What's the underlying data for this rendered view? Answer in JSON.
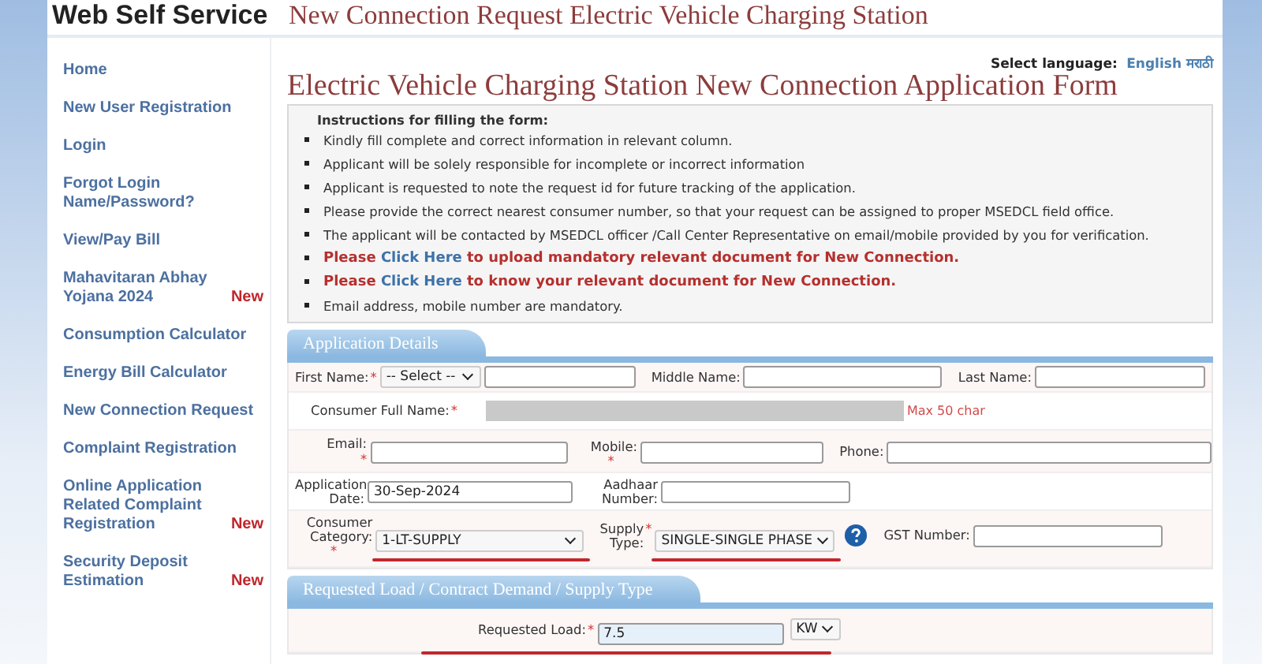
{
  "header": {
    "site_title": "Web Self Service",
    "page_title": "New Connection Request Electric Vehicle Charging Station"
  },
  "sidebar": {
    "items": [
      {
        "label": "Home"
      },
      {
        "label": "New User Registration"
      },
      {
        "label": "Login"
      },
      {
        "label": "Forgot Login Name/Password?"
      },
      {
        "label": "View/Pay Bill"
      },
      {
        "label": "Mahavitaran Abhay Yojana 2024",
        "badge": "New"
      },
      {
        "label": "Consumption Calculator"
      },
      {
        "label": "Energy Bill Calculator"
      },
      {
        "label": "New Connection Request"
      },
      {
        "label": "Complaint Registration"
      },
      {
        "label": "Online Application Related Complaint Registration",
        "badge": "New"
      },
      {
        "label": "Security Deposit Estimation",
        "badge": "New"
      }
    ]
  },
  "language": {
    "label": "Select language:",
    "options": [
      "English",
      "मराठी"
    ]
  },
  "form_title": "Electric Vehicle Charging Station New Connection Application Form",
  "instructions": {
    "heading": "Instructions for filling the form:",
    "items": [
      {
        "kind": "plain",
        "text": "Kindly fill complete and correct information in relevant column."
      },
      {
        "kind": "plain",
        "text": "Applicant will be solely responsible for incomplete or incorrect information"
      },
      {
        "kind": "plain",
        "text": "Applicant is requested to note the request id for future tracking of the application."
      },
      {
        "kind": "plain",
        "text": "Please provide the correct nearest consumer number, so that your request can be assigned to proper MSEDCL field office."
      },
      {
        "kind": "plain",
        "text": "The applicant will be contacted by MSEDCL officer /Call Center Representative on email/mobile provided by you for verification."
      },
      {
        "kind": "link",
        "before": "Please",
        "link": "Click Here",
        "after": "to upload mandatory relevant document for New Connection."
      },
      {
        "kind": "link",
        "before": "Please",
        "link": "Click Here",
        "after": "to know your relevant document for New Connection."
      },
      {
        "kind": "plain",
        "text": "Email address, mobile number are mandatory."
      }
    ]
  },
  "sections": [
    {
      "title": "Application Details",
      "rows": [
        [
          {
            "kind": "prefixed",
            "label": "First Name:",
            "asterisk": "*",
            "select": "-- Select --"
          },
          {
            "kind": "input",
            "label": "Middle Name:"
          },
          {
            "kind": "input",
            "label": "Last Name:"
          }
        ],
        [
          {
            "kind": "readonly",
            "label": "Consumer Full Name:",
            "asterisk": "*",
            "note": "Max 50 char"
          }
        ],
        [
          {
            "kind": "input",
            "label": "Email:",
            "asterisk": "*"
          },
          {
            "kind": "input",
            "label": "Mobile:",
            "asterisk": "*",
            "star_below": true
          },
          {
            "kind": "input",
            "label": "Phone:"
          }
        ],
        [
          {
            "kind": "input",
            "label": "Application Date:",
            "value": "30-Sep-2024"
          },
          {
            "kind": "input",
            "label": "Aadhaar Number:"
          }
        ],
        [
          {
            "kind": "select",
            "label": "Consumer Category:",
            "asterisk": "*",
            "star_below": true,
            "value": "1-LT-SUPPLY",
            "annotated": true
          },
          {
            "kind": "select",
            "label": "Supply Type:",
            "asterisk": "*",
            "value": "SINGLE-SINGLE PHASE",
            "help": true,
            "annotated": true
          },
          {
            "kind": "input",
            "label": "GST Number:"
          }
        ]
      ]
    },
    {
      "title": "Requested Load / Contract Demand / Supply Type",
      "rows": [
        [
          {
            "kind": "unit",
            "label": "Requested Load:",
            "asterisk": "*",
            "value": "7.5",
            "unit": "KW",
            "annotated": true,
            "highlighted": true
          }
        ]
      ]
    }
  ]
}
